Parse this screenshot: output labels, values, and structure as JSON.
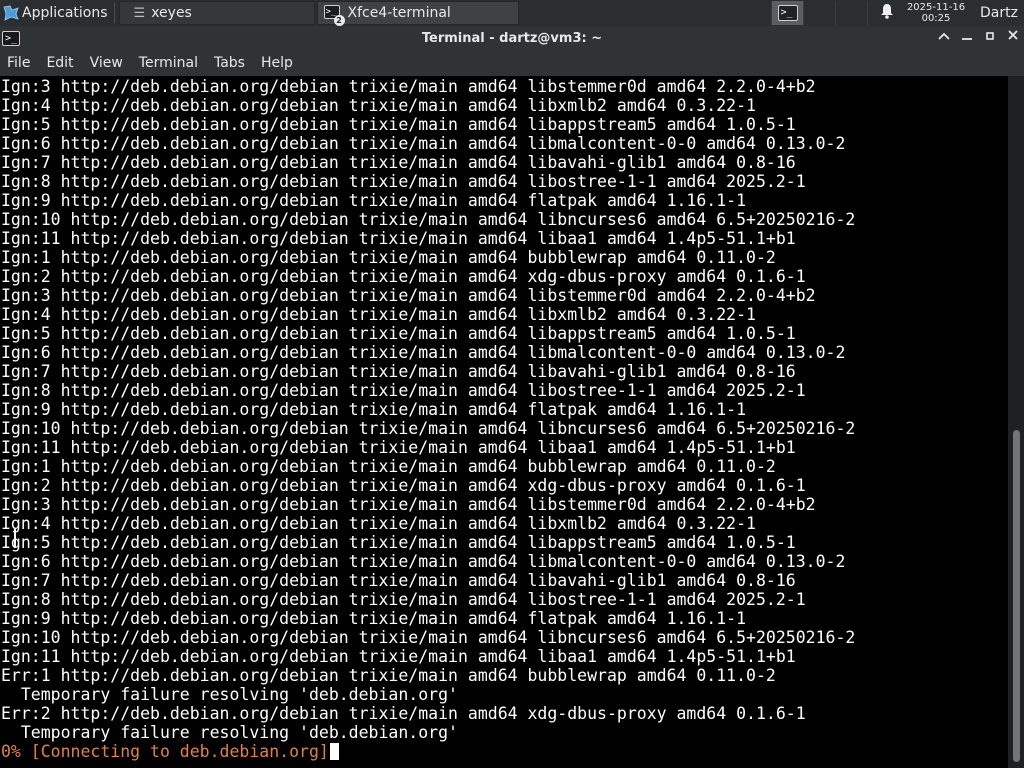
{
  "panel": {
    "apps_label": "Applications",
    "tasks": [
      {
        "label": "xeyes",
        "icon": "menu-icon"
      },
      {
        "label": "Xfce4-terminal",
        "icon": "terminal-icon",
        "badge": "2"
      }
    ],
    "clock": {
      "date": "2025-11-16",
      "time": "00:25"
    },
    "user": "Dartz"
  },
  "window": {
    "title": "Terminal - dartz@vm3: ~",
    "icon_glyph": ">_"
  },
  "menubar": [
    "File",
    "Edit",
    "View",
    "Terminal",
    "Tabs",
    "Help"
  ],
  "terminal": {
    "lines": [
      "Ign:3 http://deb.debian.org/debian trixie/main amd64 libstemmer0d amd64 2.2.0-4+b2",
      "Ign:4 http://deb.debian.org/debian trixie/main amd64 libxmlb2 amd64 0.3.22-1",
      "Ign:5 http://deb.debian.org/debian trixie/main amd64 libappstream5 amd64 1.0.5-1",
      "Ign:6 http://deb.debian.org/debian trixie/main amd64 libmalcontent-0-0 amd64 0.13.0-2",
      "Ign:7 http://deb.debian.org/debian trixie/main amd64 libavahi-glib1 amd64 0.8-16",
      "Ign:8 http://deb.debian.org/debian trixie/main amd64 libostree-1-1 amd64 2025.2-1",
      "Ign:9 http://deb.debian.org/debian trixie/main amd64 flatpak amd64 1.16.1-1",
      "Ign:10 http://deb.debian.org/debian trixie/main amd64 libncurses6 amd64 6.5+20250216-2",
      "Ign:11 http://deb.debian.org/debian trixie/main amd64 libaa1 amd64 1.4p5-51.1+b1",
      "Ign:1 http://deb.debian.org/debian trixie/main amd64 bubblewrap amd64 0.11.0-2",
      "Ign:2 http://deb.debian.org/debian trixie/main amd64 xdg-dbus-proxy amd64 0.1.6-1",
      "Ign:3 http://deb.debian.org/debian trixie/main amd64 libstemmer0d amd64 2.2.0-4+b2",
      "Ign:4 http://deb.debian.org/debian trixie/main amd64 libxmlb2 amd64 0.3.22-1",
      "Ign:5 http://deb.debian.org/debian trixie/main amd64 libappstream5 amd64 1.0.5-1",
      "Ign:6 http://deb.debian.org/debian trixie/main amd64 libmalcontent-0-0 amd64 0.13.0-2",
      "Ign:7 http://deb.debian.org/debian trixie/main amd64 libavahi-glib1 amd64 0.8-16",
      "Ign:8 http://deb.debian.org/debian trixie/main amd64 libostree-1-1 amd64 2025.2-1",
      "Ign:9 http://deb.debian.org/debian trixie/main amd64 flatpak amd64 1.16.1-1",
      "Ign:10 http://deb.debian.org/debian trixie/main amd64 libncurses6 amd64 6.5+20250216-2",
      "Ign:11 http://deb.debian.org/debian trixie/main amd64 libaa1 amd64 1.4p5-51.1+b1",
      "Ign:1 http://deb.debian.org/debian trixie/main amd64 bubblewrap amd64 0.11.0-2",
      "Ign:2 http://deb.debian.org/debian trixie/main amd64 xdg-dbus-proxy amd64 0.1.6-1",
      "Ign:3 http://deb.debian.org/debian trixie/main amd64 libstemmer0d amd64 2.2.0-4+b2",
      "Ign:4 http://deb.debian.org/debian trixie/main amd64 libxmlb2 amd64 0.3.22-1",
      "Ign:5 http://deb.debian.org/debian trixie/main amd64 libappstream5 amd64 1.0.5-1",
      "Ign:6 http://deb.debian.org/debian trixie/main amd64 libmalcontent-0-0 amd64 0.13.0-2",
      "Ign:7 http://deb.debian.org/debian trixie/main amd64 libavahi-glib1 amd64 0.8-16",
      "Ign:8 http://deb.debian.org/debian trixie/main amd64 libostree-1-1 amd64 2025.2-1",
      "Ign:9 http://deb.debian.org/debian trixie/main amd64 flatpak amd64 1.16.1-1",
      "Ign:10 http://deb.debian.org/debian trixie/main amd64 libncurses6 amd64 6.5+20250216-2",
      "Ign:11 http://deb.debian.org/debian trixie/main amd64 libaa1 amd64 1.4p5-51.1+b1",
      "Err:1 http://deb.debian.org/debian trixie/main amd64 bubblewrap amd64 0.11.0-2",
      "  Temporary failure resolving 'deb.debian.org'",
      "Err:2 http://deb.debian.org/debian trixie/main amd64 xdg-dbus-proxy amd64 0.1.6-1",
      "  Temporary failure resolving 'deb.debian.org'"
    ],
    "progress_line": "0% [Connecting to deb.debian.org]",
    "colors": {
      "foreground": "#ffffff",
      "background": "#000000",
      "progress": "#e2823c"
    }
  },
  "scrollbar": {
    "position": 0.51,
    "visible_fraction": 0.48
  }
}
